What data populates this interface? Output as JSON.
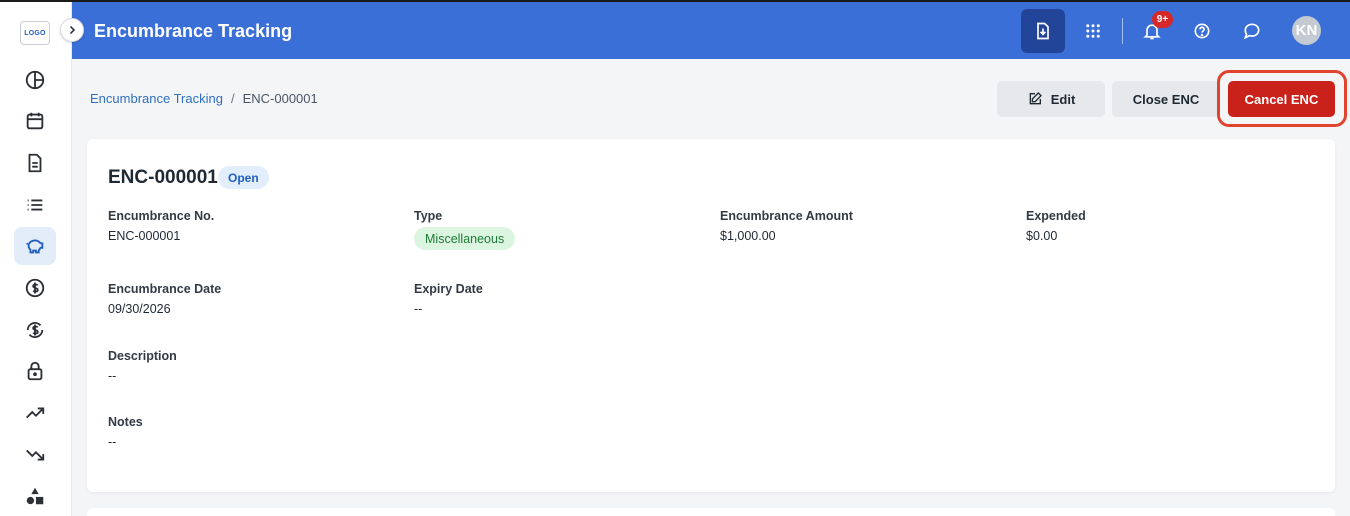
{
  "app": {
    "logo_text": "LOGO",
    "header_title": "Encumbrance Tracking",
    "notification_badge": "9+",
    "avatar_initials": "KN",
    "colors": {
      "header": "#3a6fd8",
      "accent": "#1f5fbf",
      "danger": "#c9221b"
    }
  },
  "sidebar": {
    "items": [
      {
        "icon": "chart-pie-icon",
        "active": false
      },
      {
        "icon": "calendar-icon",
        "active": false
      },
      {
        "icon": "document-icon",
        "active": false
      },
      {
        "icon": "list-icon",
        "active": false
      },
      {
        "icon": "piggy-bank-icon",
        "active": true
      },
      {
        "icon": "dollar-circle-icon",
        "active": false
      },
      {
        "icon": "dollar-exchange-icon",
        "active": false
      },
      {
        "icon": "lock-icon",
        "active": false
      },
      {
        "icon": "trending-up-icon",
        "active": false
      },
      {
        "icon": "trending-down-icon",
        "active": false
      },
      {
        "icon": "shapes-icon",
        "active": false
      }
    ]
  },
  "breadcrumb": {
    "parent": "Encumbrance Tracking",
    "separator": "/",
    "current": "ENC-000001"
  },
  "actions": {
    "edit": "Edit",
    "close": "Close ENC",
    "cancel": "Cancel ENC"
  },
  "record": {
    "title": "ENC-000001",
    "status": "Open",
    "fields": {
      "encumbrance_no": {
        "label": "Encumbrance No.",
        "value": "ENC-000001"
      },
      "type": {
        "label": "Type",
        "value": "Miscellaneous"
      },
      "amount": {
        "label": "Encumbrance Amount",
        "value": "$1,000.00"
      },
      "expended": {
        "label": "Expended",
        "value": "$0.00"
      },
      "date": {
        "label": "Encumbrance Date",
        "value": "09/30/2026"
      },
      "expiry": {
        "label": "Expiry Date",
        "value": "--"
      },
      "description": {
        "label": "Description",
        "value": "--"
      },
      "notes": {
        "label": "Notes",
        "value": "--"
      }
    }
  }
}
